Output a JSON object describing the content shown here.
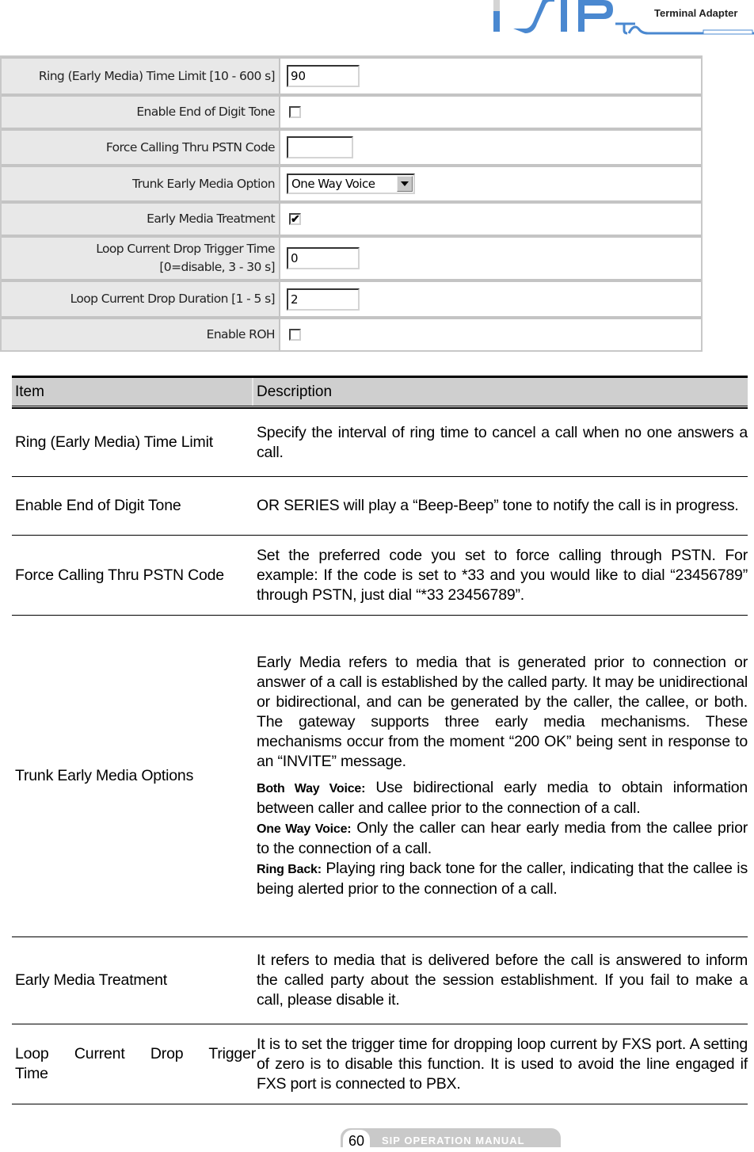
{
  "header": {
    "logo_text": "Terminal Adapter",
    "logo_brand": "SIP-TA",
    "brand_color": "#4a88d0"
  },
  "settings_form": {
    "rows": [
      {
        "label": "Ring (Early Media) Time Limit [10 - 600 s]",
        "type": "text",
        "value": "90"
      },
      {
        "label": "Enable End of Digit Tone",
        "type": "checkbox",
        "checked": false
      },
      {
        "label": "Force Calling Thru PSTN Code",
        "type": "text",
        "value": ""
      },
      {
        "label": "Trunk Early Media Option",
        "type": "select",
        "value": "One Way Voice"
      },
      {
        "label": "Early Media Treatment",
        "type": "checkbox",
        "checked": true
      },
      {
        "label_line1": "Loop Current Drop Trigger Time",
        "label_line2": "[0=disable, 3 - 30 s]",
        "type": "text",
        "value": "0"
      },
      {
        "label": "Loop Current Drop Duration [1 - 5 s]",
        "type": "text",
        "value": "2"
      },
      {
        "label": "Enable ROH",
        "type": "checkbox",
        "checked": false
      }
    ]
  },
  "description_table": {
    "headers": {
      "item": "Item",
      "description": "Description"
    },
    "rows": [
      {
        "item": "Ring (Early Media) Time Limit",
        "description": "Specify the interval of ring time to cancel a call when no one answers a call."
      },
      {
        "item": "Enable End of Digit Tone",
        "description": "OR SERIES will play a “Beep-Beep” tone to notify the call is in progress."
      },
      {
        "item": "Force Calling Thru PSTN Code",
        "description": "Set the preferred code you set to force calling through PSTN. For example: If the code is set to *33 and you would like to dial “23456789” through PSTN, just dial “*33 23456789”."
      },
      {
        "item": "Trunk Early Media Options",
        "description": "Early Media refers to media that is generated prior to connection or answer of a call is established by the called party. It may be unidirectional or bidirectional, and can be generated by the caller, the callee, or both. The gateway supports three early media mechanisms. These mechanisms occur from the moment “200 OK” being sent in response to an “INVITE” message.",
        "options": [
          {
            "name": "Both Way Voice:",
            "text": " Use bidirectional early media to obtain information between caller and callee prior to the connection of a call."
          },
          {
            "name": "One Way Voice:",
            "text": " Only the caller can hear early media from the callee prior to the connection of a call."
          },
          {
            "name": "Ring Back:",
            "text": " Playing ring back tone for the caller, indicating that the callee is being alerted prior to the connection of a call."
          }
        ]
      },
      {
        "item": "Early Media Treatment",
        "description": "It refers to media that is delivered before the call is answered to inform the called party about the session establishment. If you fail to make a call, please disable it."
      },
      {
        "item": "Loop Current Drop Trigger Time",
        "description": "It is to set the trigger time for dropping loop current by FXS port. A setting of zero is to disable this function. It is used to avoid the line engaged if FXS port is connected to PBX."
      }
    ]
  },
  "footer": {
    "page_number": "60",
    "manual_title": "SIP OPERATION MANUAL"
  }
}
